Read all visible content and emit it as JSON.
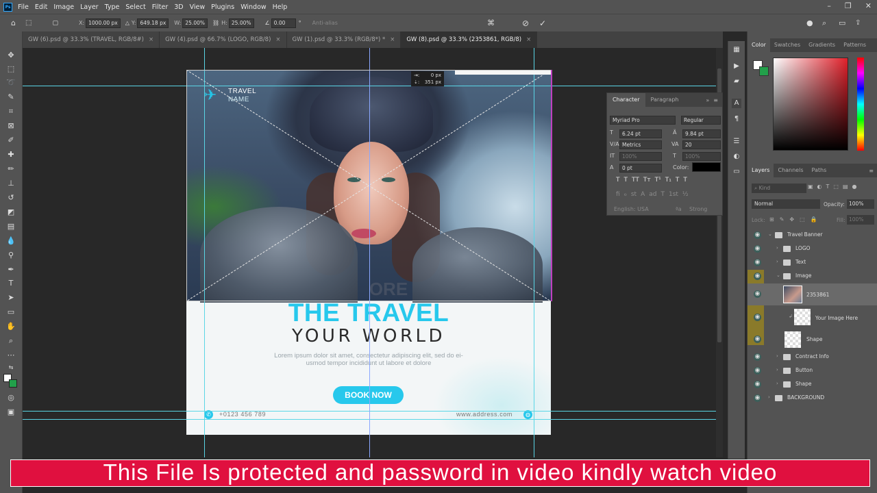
{
  "menubar": {
    "items": [
      "File",
      "Edit",
      "Image",
      "Layer",
      "Type",
      "Select",
      "Filter",
      "3D",
      "View",
      "Plugins",
      "Window",
      "Help"
    ],
    "logo_text": "Ps"
  },
  "options": {
    "x_label": "X:",
    "x_value": "1000.00 px",
    "y_label": "Y:",
    "y_value": "649.18 px",
    "w_label": "W:",
    "w_value": "25.00%",
    "h_label": "H:",
    "h_value": "25.00%",
    "angle_value": "0.00",
    "antialias_label": "Anti-alias"
  },
  "tabs": [
    {
      "label": "GW (6).psd @ 33.3% (TRAVEL, RGB/8#)"
    },
    {
      "label": "GW (4).psd @ 66.7% (LOGO, RGB/8)"
    },
    {
      "label": "GW (1).psd @ 33.3% (RGB/8*) *"
    },
    {
      "label": "GW (8).psd @ 33.3% (2353861, RGB/8)"
    }
  ],
  "banner": {
    "logo_line1": "TRAVEL",
    "logo_line2": "NAME",
    "ghost": "ORE",
    "title_line1": "THE TRAVEL",
    "title_line2": "YOUR WORLD",
    "lorem_line1": "Lorem ipsum dolor sit amet, consectetur adipiscing elit, sed do ei-",
    "lorem_line2": "usmod tempor incididunt ut labore et dolore",
    "button": "BOOK NOW",
    "phone": "+0123 456 789",
    "website": "www.address.com"
  },
  "transform_tooltip": {
    "dx": "0 px",
    "dy": "351 px"
  },
  "character": {
    "tabs": [
      "Character",
      "Paragraph"
    ],
    "font_family": "Myriad Pro",
    "font_style": "Regular",
    "font_size": "6.24 pt",
    "leading": "9.84 pt",
    "kerning": "Metrics",
    "tracking": "20",
    "vscale": "100%",
    "hscale": "100%",
    "baseline": "0 pt",
    "color_label": "Color:",
    "language": "English: USA",
    "aa": "Strong",
    "glyphs_row1": [
      "T",
      "T",
      "TT",
      "Tт",
      "T¹",
      "T₁",
      "T",
      "T"
    ],
    "glyphs_row2": [
      "fi",
      "ℴ",
      "st",
      "A",
      "ad",
      "T",
      "1st",
      "½"
    ]
  },
  "color_panel": {
    "tabs": [
      "Color",
      "Swatches",
      "Gradients",
      "Patterns"
    ]
  },
  "layers_panel": {
    "tabs": [
      "Layers",
      "Channels",
      "Paths"
    ],
    "kind_label": "Kind",
    "blend_mode": "Normal",
    "opacity_label": "Opacity:",
    "opacity": "100%",
    "lock_label": "Lock:",
    "fill_label": "Fill:",
    "fill": "100%",
    "layers": [
      {
        "name": "Travel Banner"
      },
      {
        "name": "LOGO"
      },
      {
        "name": "Text"
      },
      {
        "name": "Image"
      },
      {
        "name": "2353861"
      },
      {
        "name": "Your Image Here"
      },
      {
        "name": "Shape"
      },
      {
        "name": "Contract Info"
      },
      {
        "name": "Button"
      },
      {
        "name": "Shape"
      },
      {
        "name": "BACKGROUND"
      }
    ]
  },
  "notice": "This File Is protected and password in video kindly watch video",
  "colors": {
    "accent": "#27c8ec",
    "notice_bg": "#e0103f",
    "highlight": "#8a7a2a"
  }
}
